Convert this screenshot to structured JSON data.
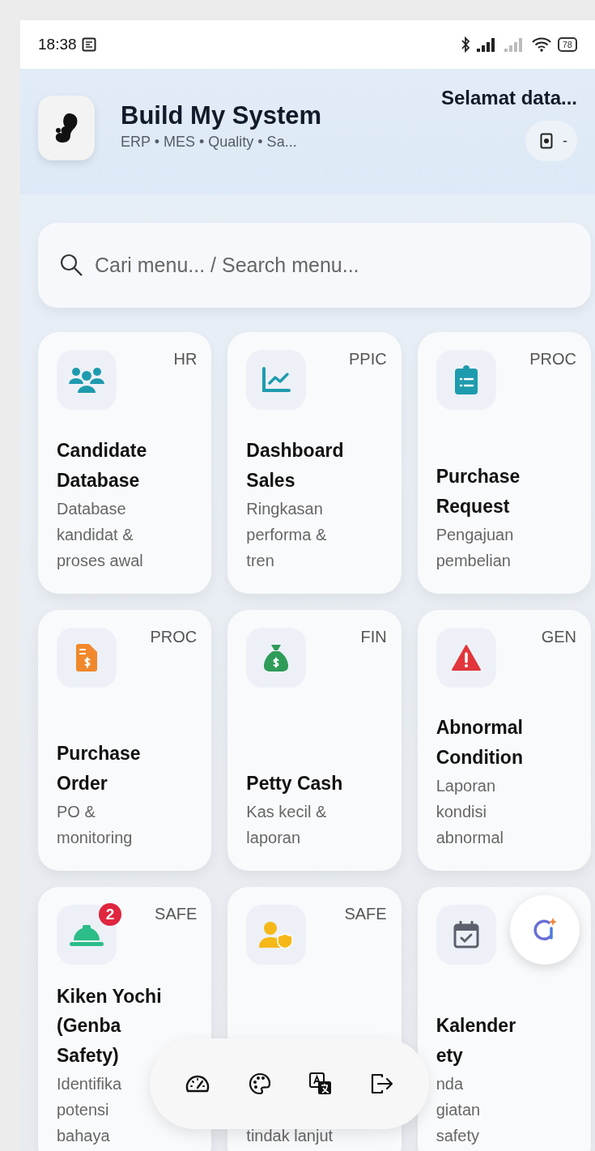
{
  "status_bar": {
    "time": "18:38",
    "battery": "78"
  },
  "header": {
    "title": "Build My System",
    "subtitle": "ERP • MES • Quality • Sa...",
    "greeting": "Selamat data...",
    "device_label": "-"
  },
  "search": {
    "placeholder": "Cari menu... / Search menu..."
  },
  "cards": [
    {
      "kind": "people",
      "tag": "HR",
      "title": "Candidate Database",
      "desc": "Database kandidat & proses awal"
    },
    {
      "kind": "chart",
      "tag": "PPIC",
      "title": "Dashboard Sales",
      "desc": "Ringkasan performa & tren"
    },
    {
      "kind": "clipboard",
      "tag": "PROC",
      "title": "Purchase Request",
      "desc": "Pengajuan pembelian"
    },
    {
      "kind": "invoice",
      "tag": "PROC",
      "title": "Purchase Order",
      "desc": "PO & monitoring"
    },
    {
      "kind": "moneybag",
      "tag": "FIN",
      "title": "Petty Cash",
      "desc": "Kas kecil & laporan"
    },
    {
      "kind": "warning",
      "tag": "GEN",
      "title": "Abnormal Condition",
      "desc": "Laporan kondisi abnormal"
    },
    {
      "kind": "helmet",
      "tag": "SAFE",
      "badge": "2",
      "title": "Kiken Yochi (Genba Safety)",
      "desc": "Identifika\npotensi\nbahaya"
    },
    {
      "kind": "shielduser",
      "tag": "SAFE",
      "desc": "tindak lanjut"
    },
    {
      "kind": "calendar",
      "title": "Kalender\nety",
      "desc": "nda\ngiatan\nsafety"
    }
  ],
  "bottom_nav": [
    {
      "kind": "gauge"
    },
    {
      "kind": "palette"
    },
    {
      "kind": "translate"
    },
    {
      "kind": "logout"
    }
  ]
}
